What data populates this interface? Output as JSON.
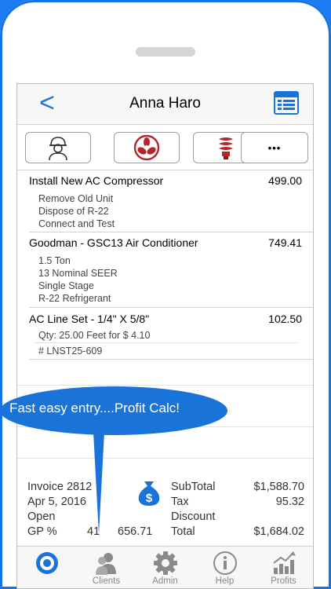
{
  "header": {
    "back_glyph": "<",
    "title": "Anna Haro"
  },
  "toolbar": {
    "more_label": "•••"
  },
  "items": [
    {
      "name": "Install New AC Compressor",
      "price": "499.00",
      "details": [
        "Remove Old Unit",
        "Dispose of R-22",
        "Connect and Test"
      ]
    },
    {
      "name": "Goodman - GSC13 Air Conditioner",
      "price": "749.41",
      "details": [
        "1.5 Ton",
        "13 Nominal SEER",
        "Single Stage",
        "R-22 Refrigerant"
      ]
    },
    {
      "name": "AC Line Set - 1/4\" X 5/8\"",
      "price": "102.50",
      "qty": "Qty:   25.00 Feet for $  4.10",
      "part": "# LNST25-609"
    }
  ],
  "callout": "Fast easy entry....Profit Calc!",
  "summary": {
    "invoice": "Invoice 2812",
    "date": "Apr 5, 2016",
    "status": "Open",
    "gp_label": "GP %",
    "gp_percent": "41",
    "gp_amount": "656.71",
    "subtotal_label": "SubTotal",
    "subtotal": "$1,588.70",
    "tax_label": "Tax",
    "tax": "95.32",
    "discount_label": "Discount",
    "total_label": "Total",
    "total": "$1,684.02"
  },
  "tabs": [
    {
      "label": ""
    },
    {
      "label": "Clients"
    },
    {
      "label": "Admin"
    },
    {
      "label": "Help"
    },
    {
      "label": "Profits"
    }
  ],
  "colors": {
    "accent": "#1a73d9",
    "frame": "#1b7bf0",
    "fan": "#b5262c"
  },
  "icons": [
    "back-chevron-icon",
    "list-view-icon",
    "technician-icon",
    "fan-icon",
    "light-bulb-icon",
    "more-icon",
    "target-icon",
    "clients-icon",
    "gear-icon",
    "info-icon",
    "chart-icon",
    "money-bag-icon"
  ]
}
